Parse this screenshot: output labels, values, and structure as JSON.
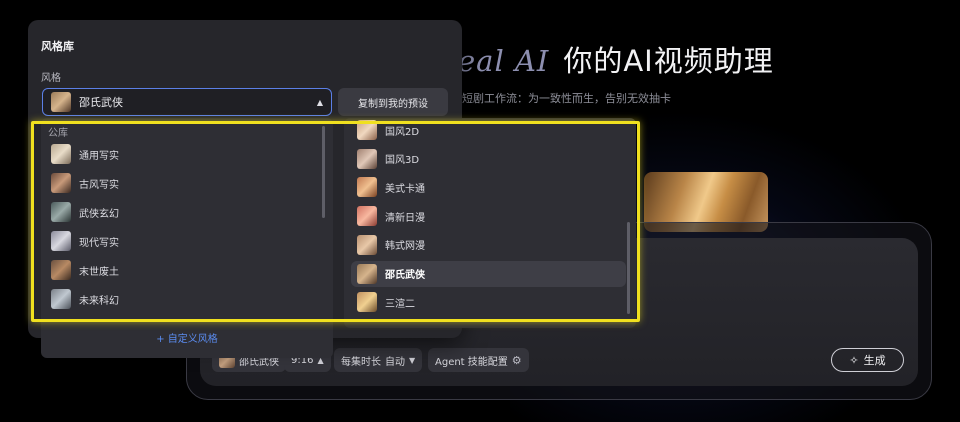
{
  "hero": {
    "title_italic": "eal  AI",
    "title_main": "你的AI视频助理",
    "subtitle": "短剧工作流：为一致性而生，告别无效抽卡"
  },
  "toolbar": {
    "style_chip": "邵氏武侠",
    "ratio": "9:16",
    "duration_label": "每集时长",
    "duration_value": "自动",
    "agent_label": "Agent 技能配置",
    "generate_label": "生成"
  },
  "panel": {
    "title": "风格库",
    "field_label": "风格",
    "selected_value": "邵氏武侠",
    "copy_button": "复制到我的预设",
    "custom_button": "+ 自定义风格"
  },
  "left_list": {
    "group_label": "公库",
    "items": [
      {
        "label": "通用写实",
        "thumb": [
          "#b8a890",
          "#e8dcc8",
          "#7a6a58"
        ]
      },
      {
        "label": "古风写实",
        "thumb": [
          "#6a4a3a",
          "#c89a7a",
          "#3a2820"
        ]
      },
      {
        "label": "武侠玄幻",
        "thumb": [
          "#4a5a5a",
          "#9aaaa8",
          "#2a3434"
        ]
      },
      {
        "label": "现代写实",
        "thumb": [
          "#8a8a9a",
          "#d8d8e0",
          "#5a5a68"
        ]
      },
      {
        "label": "末世废土",
        "thumb": [
          "#6a5040",
          "#b88a64",
          "#3a2a20"
        ]
      },
      {
        "label": "未来科幻",
        "thumb": [
          "#7a8088",
          "#c0c8d0",
          "#4a5058"
        ]
      }
    ]
  },
  "right_list": {
    "items": [
      {
        "label": "国风2D",
        "selected": false,
        "thumb": [
          "#c8a080",
          "#f0d8c0",
          "#8a6048"
        ]
      },
      {
        "label": "国风3D",
        "selected": false,
        "thumb": [
          "#a08070",
          "#e0c8b8",
          "#5a4034"
        ]
      },
      {
        "label": "美式卡通",
        "selected": false,
        "thumb": [
          "#c07850",
          "#f0c090",
          "#7a4020"
        ]
      },
      {
        "label": "清新日漫",
        "selected": false,
        "thumb": [
          "#d07060",
          "#f8b8a0",
          "#8a3a30"
        ]
      },
      {
        "label": "韩式网漫",
        "selected": false,
        "thumb": [
          "#b89070",
          "#e8c8a8",
          "#6a4a34"
        ]
      },
      {
        "label": "邵氏武侠",
        "selected": true,
        "thumb": [
          "#9a7a58",
          "#d6b48c",
          "#4e3626"
        ]
      },
      {
        "label": "三渲二",
        "selected": false,
        "thumb": [
          "#c09060",
          "#f0d090",
          "#6a4a28"
        ]
      }
    ]
  },
  "colors": {
    "accent_blue": "#5b8cf0",
    "highlight_yellow": "#f0e01f"
  }
}
